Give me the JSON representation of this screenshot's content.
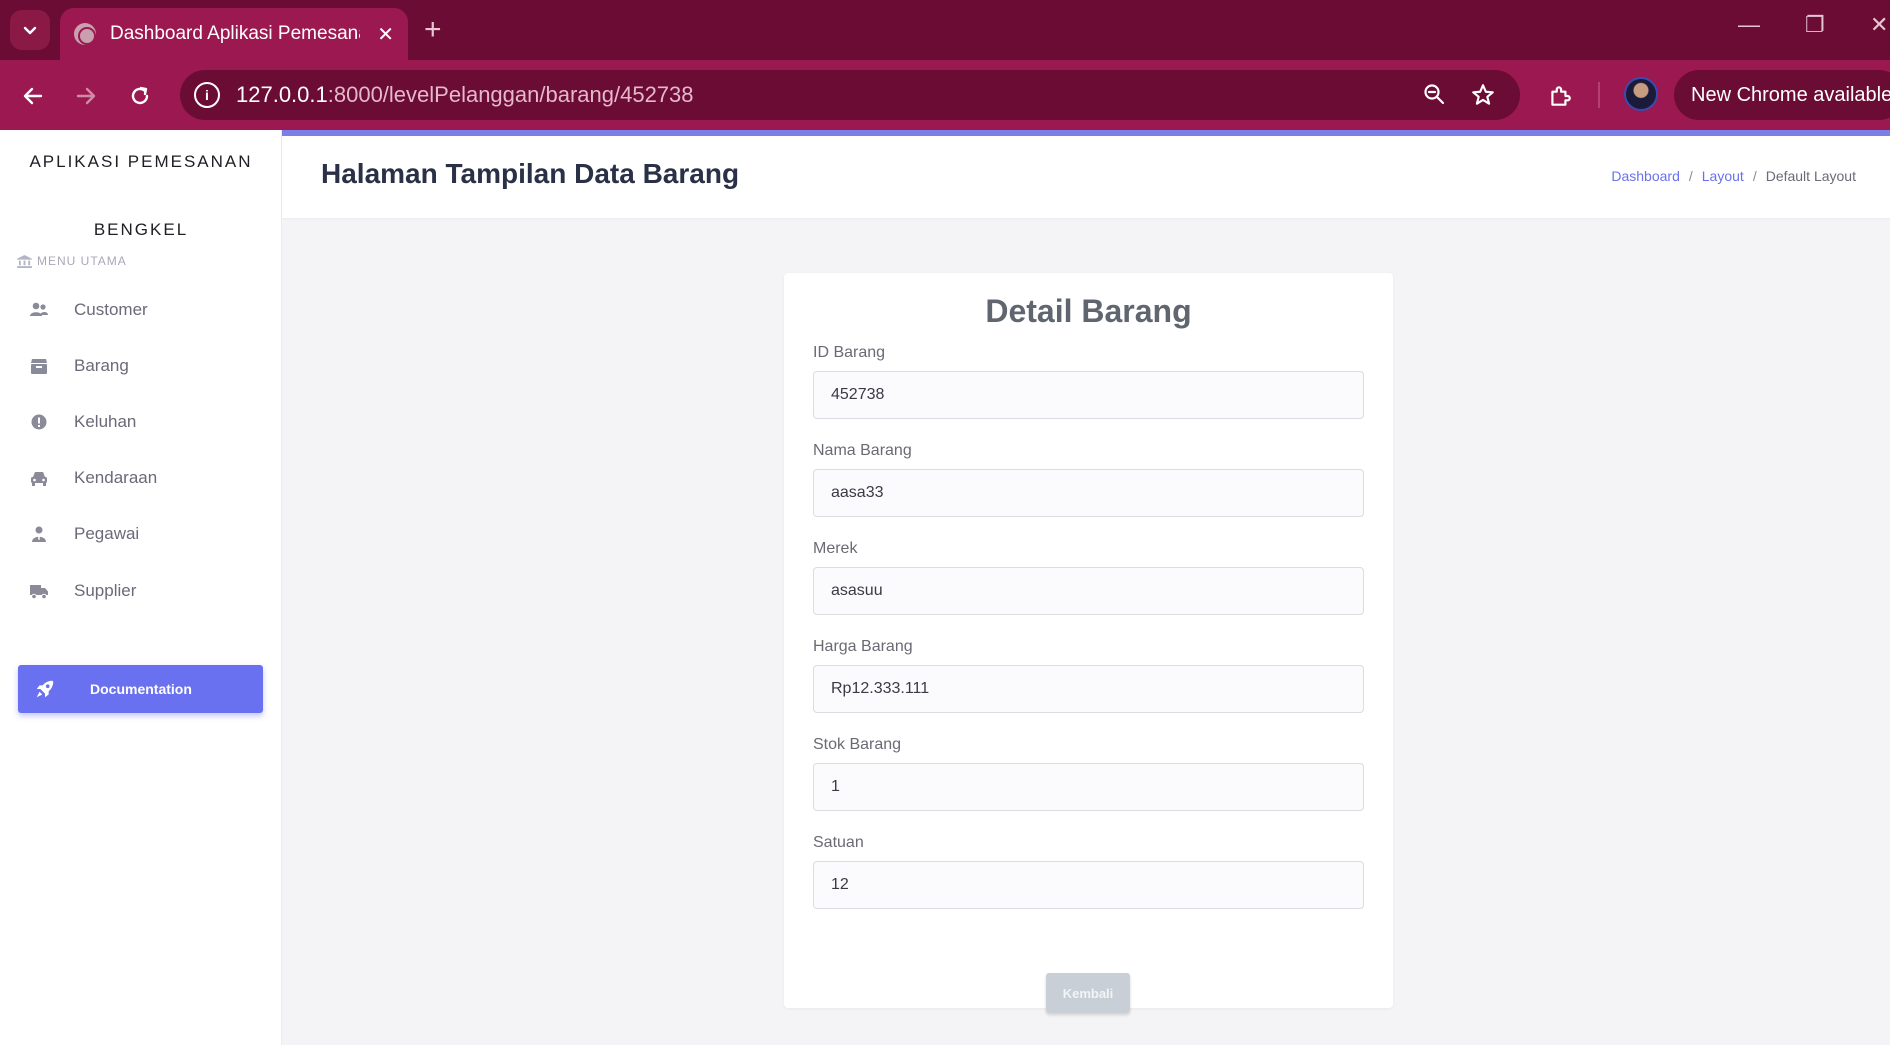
{
  "browser": {
    "tab_title": "Dashboard Aplikasi Pemesanan",
    "url_host": "127.0.0.1",
    "url_rest": ":8000/levelPelanggan/barang/452738",
    "new_chrome_label": "New Chrome available"
  },
  "sidebar": {
    "brand_line1": "APLIKASI PEMESANAN",
    "brand_line2": "BENGKEL",
    "menu_heading": "MENU UTAMA",
    "items": [
      {
        "label": "Customer",
        "icon": "users-icon"
      },
      {
        "label": "Barang",
        "icon": "box-icon"
      },
      {
        "label": "Keluhan",
        "icon": "exclamation-circle-icon"
      },
      {
        "label": "Kendaraan",
        "icon": "car-icon"
      },
      {
        "label": "Pegawai",
        "icon": "user-tie-icon"
      },
      {
        "label": "Supplier",
        "icon": "truck-icon"
      }
    ],
    "documentation_label": "Documentation"
  },
  "header": {
    "title": "Halaman Tampilan Data Barang",
    "breadcrumb": [
      "Dashboard",
      "Layout",
      "Default Layout"
    ]
  },
  "card": {
    "title": "Detail Barang",
    "fields": [
      {
        "label": "ID Barang",
        "value": "452738"
      },
      {
        "label": "Nama Barang",
        "value": "aasa33"
      },
      {
        "label": "Merek",
        "value": "asasuu"
      },
      {
        "label": "Harga Barang",
        "value": "Rp12.333.111"
      },
      {
        "label": "Stok Barang",
        "value": "1"
      },
      {
        "label": "Satuan",
        "value": "12"
      }
    ],
    "back_label": "Kembali"
  },
  "colors": {
    "chrome_dark": "#6b0c34",
    "chrome_tab": "#9c1850",
    "accent": "#6a71f0"
  }
}
